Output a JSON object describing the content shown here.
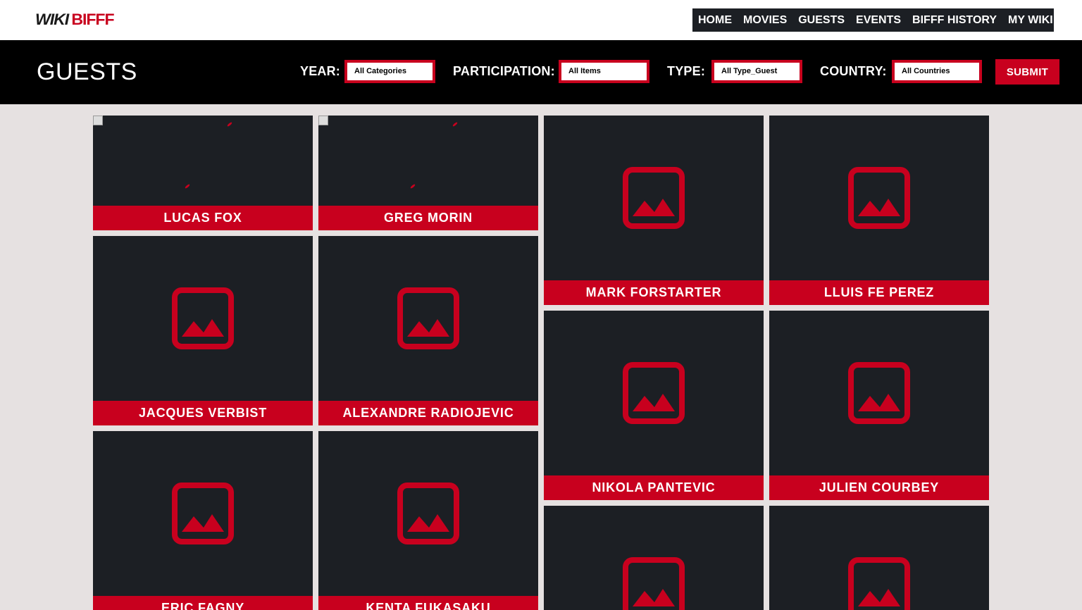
{
  "header": {
    "logo_wiki": "WIKI",
    "logo_biff": "BIFFF",
    "nav": [
      "HOME",
      "MOVIES",
      "GUESTS",
      "EVENTS",
      "BIFFF HISTORY",
      "MY WIKI"
    ],
    "caret": "▼"
  },
  "filters": {
    "title": "GUESTS",
    "year_label": "YEAR:",
    "year_value": "All Categories",
    "participation_label": "PARTICIPATION:",
    "participation_value": "All Items",
    "type_label": "TYPE:",
    "type_value": "All Type_Guest",
    "country_label": "COUNTRY:",
    "country_value": "All Countries",
    "submit": "SUBMIT"
  },
  "guests": [
    {
      "name": "LUCAS FOX",
      "image": "broken"
    },
    {
      "name": "GREG MORIN",
      "image": "broken"
    },
    {
      "name": "MARK FORSTARTER",
      "image": "placeholder"
    },
    {
      "name": "LLUIS FE PEREZ",
      "image": "placeholder"
    },
    {
      "name": "JACQUES VERBIST",
      "image": "placeholder"
    },
    {
      "name": "ALEXANDRE RADIOJEVIC",
      "image": "placeholder"
    },
    {
      "name": "NIKOLA PANTEVIC",
      "image": "placeholder"
    },
    {
      "name": "JULIEN COURBEY",
      "image": "placeholder"
    },
    {
      "name": "ERIC FAGNY",
      "image": "placeholder"
    },
    {
      "name": "KENTA FUKASAKU",
      "image": "placeholder"
    },
    {
      "name": "",
      "image": "placeholder"
    },
    {
      "name": "",
      "image": "placeholder"
    }
  ],
  "colors": {
    "accent": "#c8001e",
    "card_bg": "#1c1f24",
    "page_bg": "#e6e1e1",
    "filter_bar": "#000000"
  }
}
